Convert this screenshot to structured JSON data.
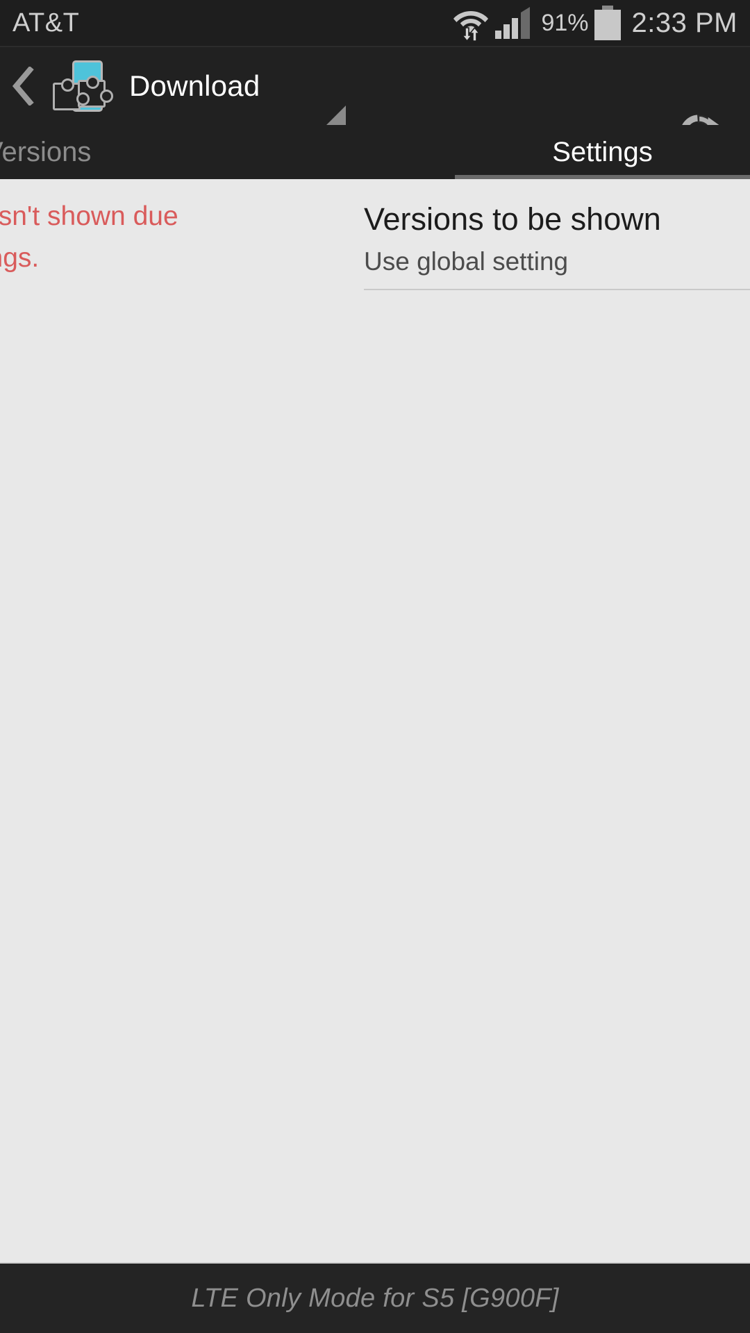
{
  "status_bar": {
    "carrier": "AT&T",
    "wifi_icon": "wifi-with-transfer-arrows-icon",
    "signal_icon": "cellular-signal-icon",
    "battery_percent": "91%",
    "battery_icon": "battery-full-icon",
    "clock": "2:33 PM"
  },
  "action_bar": {
    "back_icon": "back-chevron-icon",
    "app_icon": "xposed-puzzle-phone-icon",
    "title": "Download",
    "spinner_caret_icon": "dropdown-caret-icon",
    "refresh_icon": "refresh-icon"
  },
  "tabs": [
    {
      "label": "Versions",
      "selected": false
    },
    {
      "label": "Settings",
      "selected": true
    }
  ],
  "content": {
    "warning": {
      "line1": "ever it isn't shown due",
      "line2": "ic settings.",
      "color": "#d95b5b"
    },
    "preferences": [
      {
        "title": "Versions to be shown",
        "summary": "Use global setting"
      }
    ]
  },
  "bottom_bar": {
    "text": "LTE Only Mode for S5 [G900F]"
  },
  "colors": {
    "status_bar_bg": "#1e1e1e",
    "action_bar_bg": "#212121",
    "content_bg": "#e8e8e8",
    "accent_cyan": "#4ec3da",
    "warning_red": "#d95b5b",
    "tab_indicator": "#6b6b6b"
  }
}
